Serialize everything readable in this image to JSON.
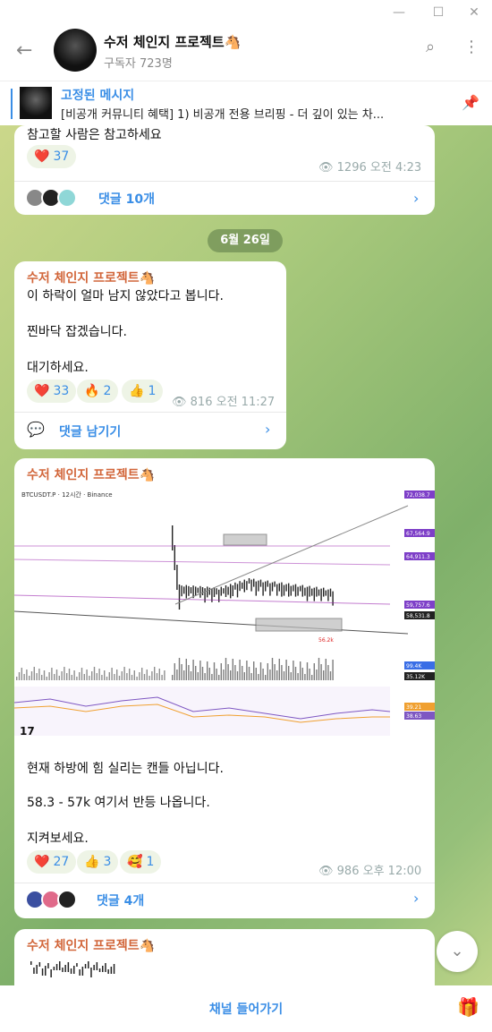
{
  "window": {
    "min": "—",
    "max": "☐",
    "close": "✕"
  },
  "header": {
    "title": "수저 체인지 프로젝트🐴",
    "subscribers": "구독자 723명"
  },
  "pinned": {
    "title": "고정된 메시지",
    "text": "[비공개 커뮤니티 혜택] 1) 비공개 전용 브리핑 - 더 깊이 있는 차..."
  },
  "post1": {
    "text": "참고할 사람은 참고하세요",
    "reaction": {
      "emoji": "❤️",
      "count": "37"
    },
    "views": "1296",
    "time": "오전 4:23",
    "comments": "댓글 10개"
  },
  "date": "6월 26일",
  "post2": {
    "sender": "수저 체인지 프로젝트🐴",
    "lines": [
      "이 하락이 얼마 남지 않았다고 봅니다.",
      "찐바닥 잡겠습니다.",
      "대기하세요."
    ],
    "reactions": [
      {
        "emoji": "❤️",
        "count": "33"
      },
      {
        "emoji": "🔥",
        "count": "2"
      },
      {
        "emoji": "👍",
        "count": "1"
      }
    ],
    "views": "816",
    "time": "오전 11:27",
    "comments": "댓글 남기기"
  },
  "post3": {
    "sender": "수저 체인지 프로젝트🐴",
    "chart_header": "BTCUSDT.P · 12시간 · Binance",
    "chart_labels": [
      "72,038.7",
      "67,564.9",
      "64,911.3",
      "59,757.6",
      "58,531.8",
      "56.2k",
      "99.4K",
      "35.12K",
      "39.21",
      "38.63"
    ],
    "lines": [
      "현재 하방에 힘 실리는 캔들 아닙니다.",
      "58.3 - 57k 여기서 반등 나옵니다.",
      "지켜보세요."
    ],
    "reactions": [
      {
        "emoji": "❤️",
        "count": "27"
      },
      {
        "emoji": "👍",
        "count": "3"
      },
      {
        "emoji": "🥰",
        "count": "1"
      }
    ],
    "views": "986",
    "time": "오후 12:00",
    "comments": "댓글 4개"
  },
  "post4": {
    "sender": "수저 체인지 프로젝트🐴"
  },
  "bottom": {
    "join": "채널 들어가기"
  },
  "colors": {
    "accent": "#3a8ee6",
    "sender": "#d2663a"
  }
}
